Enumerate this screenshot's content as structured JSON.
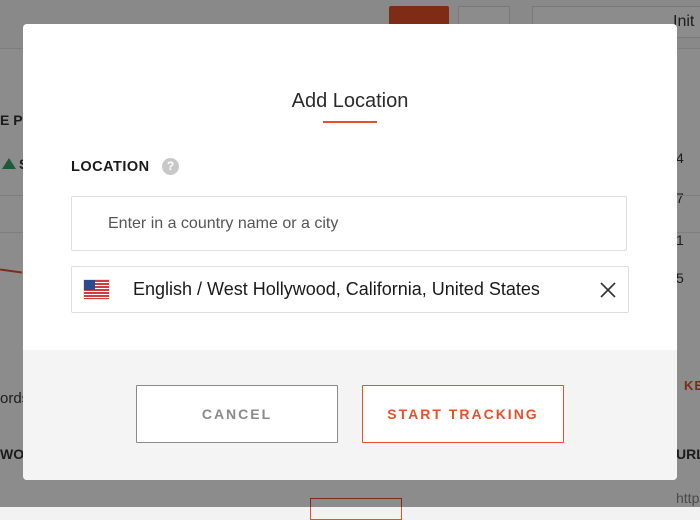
{
  "background": {
    "fragment_top_right": "Init",
    "fragment_pos": "E PO",
    "fragment_s": "S",
    "fragment_num_1": "4",
    "fragment_num_2": "7",
    "fragment_num_3": "1",
    "fragment_num_4": "5",
    "fragment_words": "ords",
    "fragment_wo": "WO",
    "fragment_ke": "KE",
    "fragment_url": "URL",
    "fragment_http": "http"
  },
  "modal": {
    "title": "Add Location",
    "section_label": "LOCATION",
    "help_glyph": "?",
    "search": {
      "placeholder": "Enter in a country name or a city",
      "value": ""
    },
    "selected_location": {
      "flag_icon": "us-flag-icon",
      "label": "English / West Hollywood, California, United States",
      "remove_icon": "close-icon"
    },
    "buttons": {
      "cancel": "CANCEL",
      "start": "START TRACKING"
    },
    "colors": {
      "accent": "#e8502a",
      "overlay": "rgba(0,0,0,0.45)"
    }
  }
}
